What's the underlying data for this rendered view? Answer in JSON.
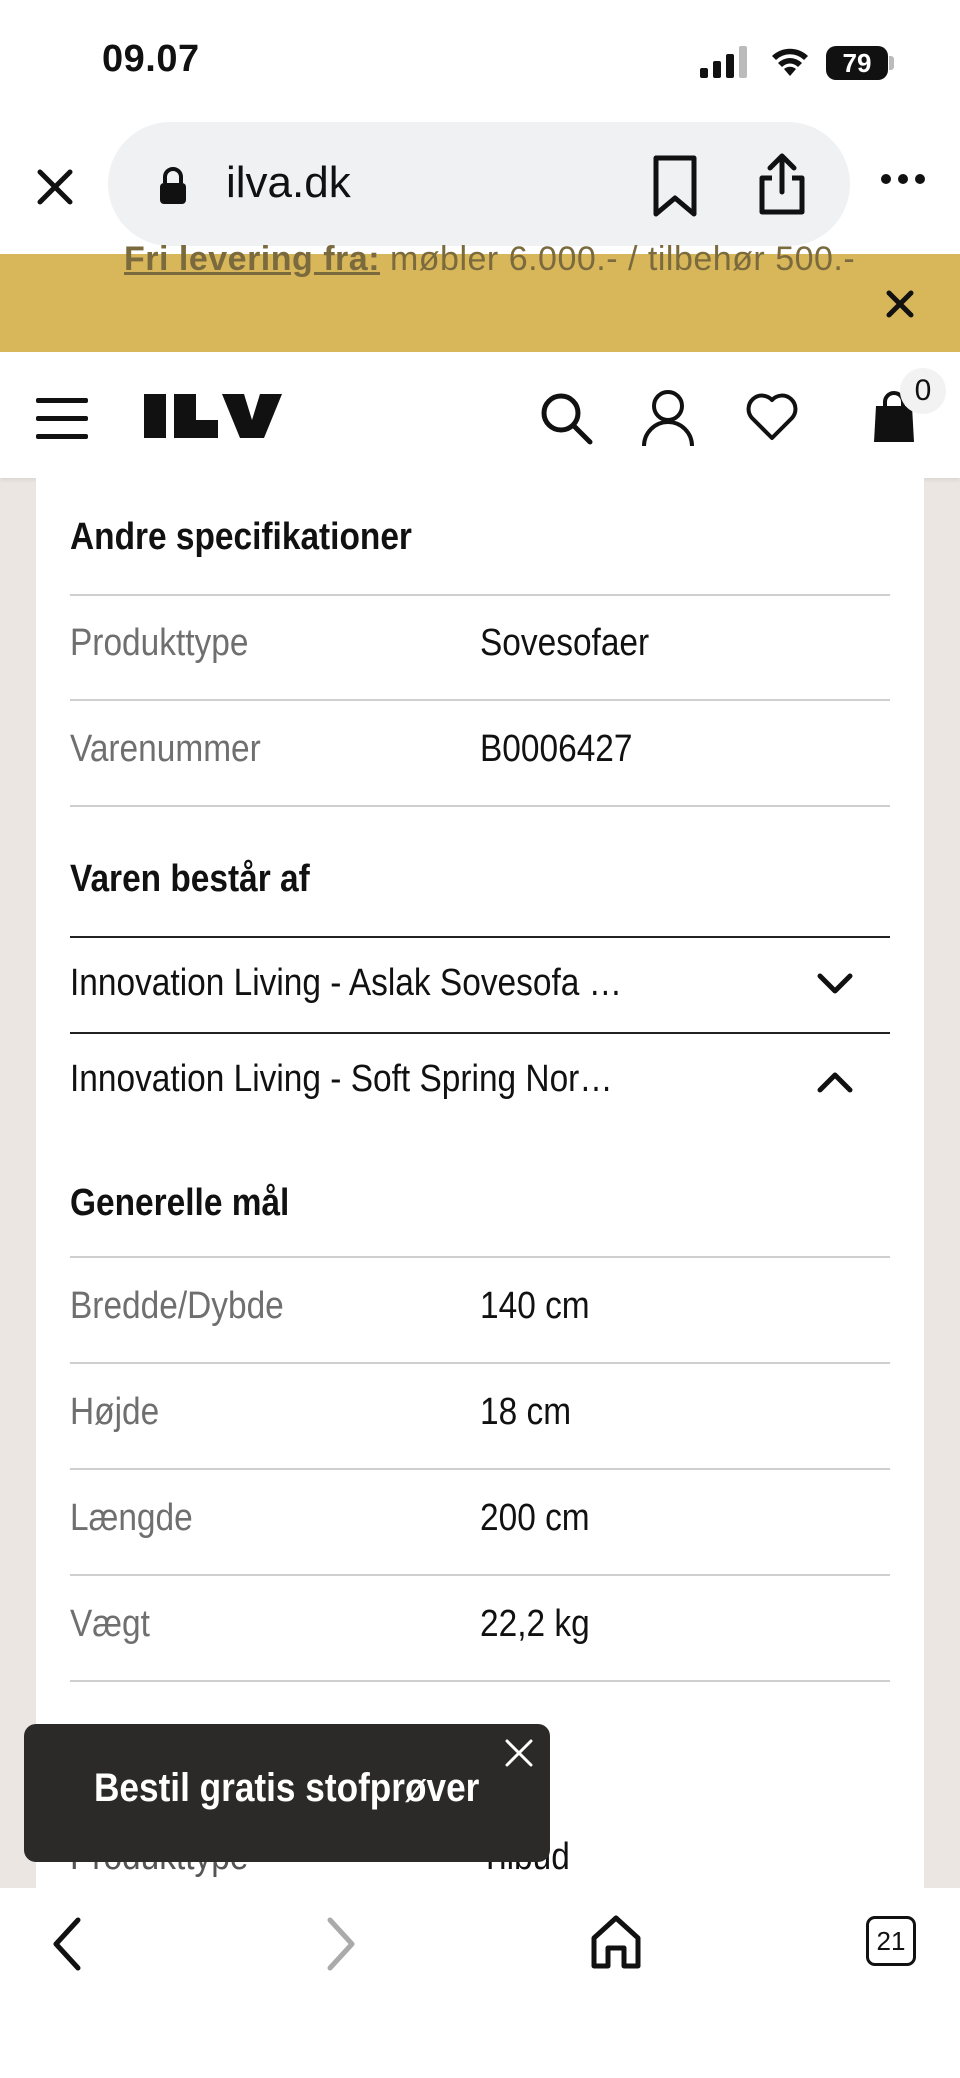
{
  "status_bar": {
    "time": "09.07",
    "battery": "79",
    "icons": [
      "signal-icon",
      "wifi-icon",
      "battery-icon"
    ]
  },
  "browser": {
    "url": "ilva.dk",
    "icons": [
      "close-icon",
      "lock-icon",
      "bookmark-icon",
      "share-icon",
      "more-icon"
    ]
  },
  "promo": {
    "label": "Fri levering fra:",
    "text": " møbler 6.000.- / tilbehør 500.-"
  },
  "header": {
    "logo": "ILVA",
    "cart_count": "0",
    "icons": [
      "menu-icon",
      "search-icon",
      "user-icon",
      "heart-icon",
      "bag-icon"
    ]
  },
  "sections": {
    "other_specs": {
      "title": "Andre specifikationer",
      "rows": [
        {
          "label": "Produkttype",
          "value": "Sovesofaer"
        },
        {
          "label": "Varenummer",
          "value": "B0006427"
        }
      ]
    },
    "consists_of": {
      "title": "Varen består af",
      "items": [
        {
          "label": "Innovation Living - Aslak Sovesofa …",
          "state": "collapsed"
        },
        {
          "label": "Innovation Living - Soft Spring Nor…",
          "state": "expanded"
        }
      ]
    },
    "general_dims": {
      "title": "Generelle mål",
      "rows": [
        {
          "label": "Bredde/Dybde",
          "value": "140 cm"
        },
        {
          "label": "Højde",
          "value": "18 cm"
        },
        {
          "label": "Længde",
          "value": "200 cm"
        },
        {
          "label": "Vægt",
          "value": "22,2 kg"
        }
      ]
    },
    "partial_row": {
      "label": "Produkttype",
      "value": "Tilbud"
    }
  },
  "toast": {
    "text": "Bestil gratis stofprøver"
  },
  "toolbar": {
    "tabs_count": "21",
    "icons": [
      "back-icon",
      "forward-icon",
      "home-icon",
      "tabs-icon"
    ]
  },
  "colors": {
    "promo_bg": "#d8b75b",
    "toast_bg": "#2b2a28",
    "page_bg": "#ebe6e1"
  }
}
